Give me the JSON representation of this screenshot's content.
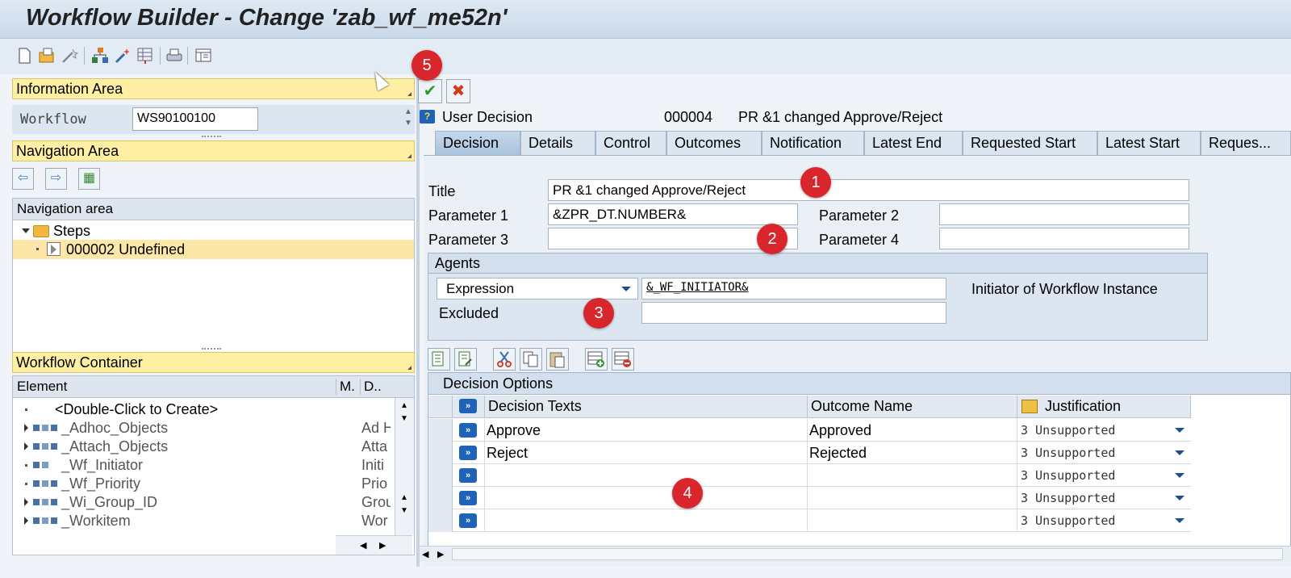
{
  "window": {
    "title": "Workflow Builder - Change 'zab_wf_me52n'"
  },
  "left": {
    "information_area": "Information Area",
    "workflow_label": "Workflow",
    "workflow_value": "WS90100100",
    "navigation_area_bar": "Navigation Area",
    "navigation_area_header": "Navigation area",
    "tree": {
      "root": "Steps",
      "child": "000002 Undefined"
    },
    "workflow_container": "Workflow Container",
    "container_columns": [
      "Element",
      "M.",
      "D.."
    ],
    "container_rows": [
      {
        "name": "<Double-Click to Create>",
        "desc": ""
      },
      {
        "name": "_Adhoc_Objects",
        "desc": "Ad H"
      },
      {
        "name": "_Attach_Objects",
        "desc": "Atta"
      },
      {
        "name": "_Wf_Initiator",
        "desc": "Initi"
      },
      {
        "name": "_Wf_Priority",
        "desc": "Prio"
      },
      {
        "name": "_Wi_Group_ID",
        "desc": "Grou"
      },
      {
        "name": "_Workitem",
        "desc": "Wor"
      }
    ]
  },
  "step": {
    "type": "User Decision",
    "number": "000004",
    "description": "PR &1 changed Approve/Reject"
  },
  "tabs": [
    "Decision",
    "Details",
    "Control",
    "Outcomes",
    "Notification",
    "Latest End",
    "Requested Start",
    "Latest Start",
    "Reques..."
  ],
  "decision": {
    "title_label": "Title",
    "title_value": "PR &1 changed Approve/Reject",
    "param1_label": "Parameter 1",
    "param1_value": "&ZPR_DT.NUMBER&",
    "param2_label": "Parameter 2",
    "param2_value": "",
    "param3_label": "Parameter 3",
    "param3_value": "",
    "param4_label": "Parameter 4",
    "param4_value": "",
    "agents_header": "Agents",
    "agent_type": "Expression",
    "agent_value": "&_WF_INITIATOR&",
    "agent_description": "Initiator of Workflow Instance",
    "excluded_label": "Excluded",
    "excluded_value": ""
  },
  "options": {
    "header": "Decision Options",
    "columns": [
      "Decision Texts",
      "Outcome Name",
      "Justification"
    ],
    "rows": [
      {
        "text": "Approve",
        "outcome": "Approved",
        "justification": "3 Unsupported"
      },
      {
        "text": "Reject",
        "outcome": "Rejected",
        "justification": "3 Unsupported"
      },
      {
        "text": "",
        "outcome": "",
        "justification": "3 Unsupported"
      },
      {
        "text": "",
        "outcome": "",
        "justification": "3 Unsupported"
      },
      {
        "text": "",
        "outcome": "",
        "justification": "3 Unsupported"
      }
    ]
  },
  "annotations": [
    "1",
    "2",
    "3",
    "4",
    "5"
  ],
  "colors": {
    "badge": "#d8262c",
    "yellow_bar": "#ffefa3",
    "accept": "#2e9a2e",
    "cancel": "#d23a1a"
  }
}
